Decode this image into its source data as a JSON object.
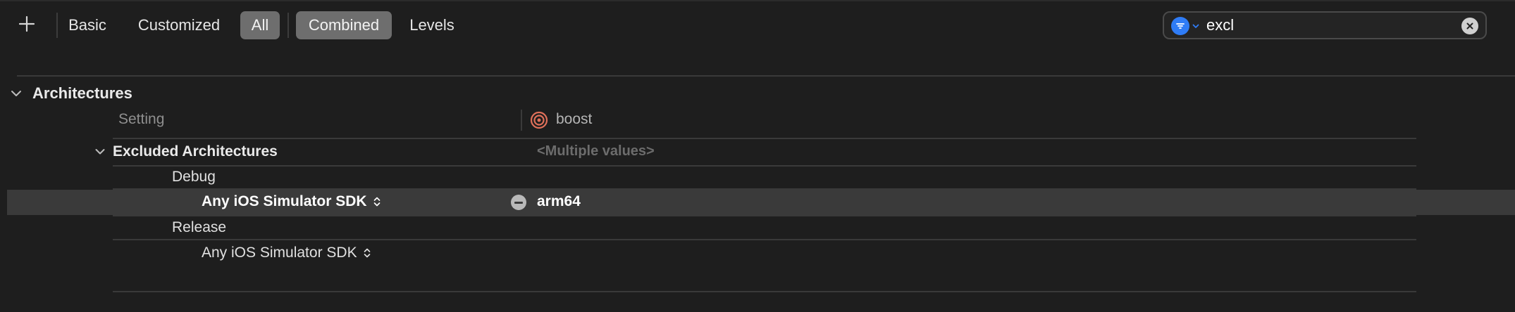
{
  "toolbar": {
    "add_label": "+",
    "filters": [
      "Basic",
      "Customized",
      "All"
    ],
    "selected_filter": "All",
    "views": [
      "Combined",
      "Levels"
    ],
    "selected_view": "Combined",
    "search": {
      "value": "excl",
      "filter_icon": "filter-icon"
    }
  },
  "section": {
    "title": "Architectures",
    "column_setting": "Setting",
    "column_target": "boost",
    "target_icon": "target-icon"
  },
  "setting": {
    "name": "Excluded Architectures",
    "summary": "<Multiple values>",
    "configs": [
      {
        "name": "Debug",
        "condition": "Any iOS Simulator SDK",
        "value": "arm64"
      },
      {
        "name": "Release",
        "condition": "Any iOS Simulator SDK",
        "value": ""
      }
    ]
  },
  "colors": {
    "background": "#1e1e1e",
    "selected_segment": "#6e6e6e",
    "accent_blue": "#2f7cf6",
    "highlight_row": "#3a3a3a",
    "target_icon": "#e0705a"
  }
}
